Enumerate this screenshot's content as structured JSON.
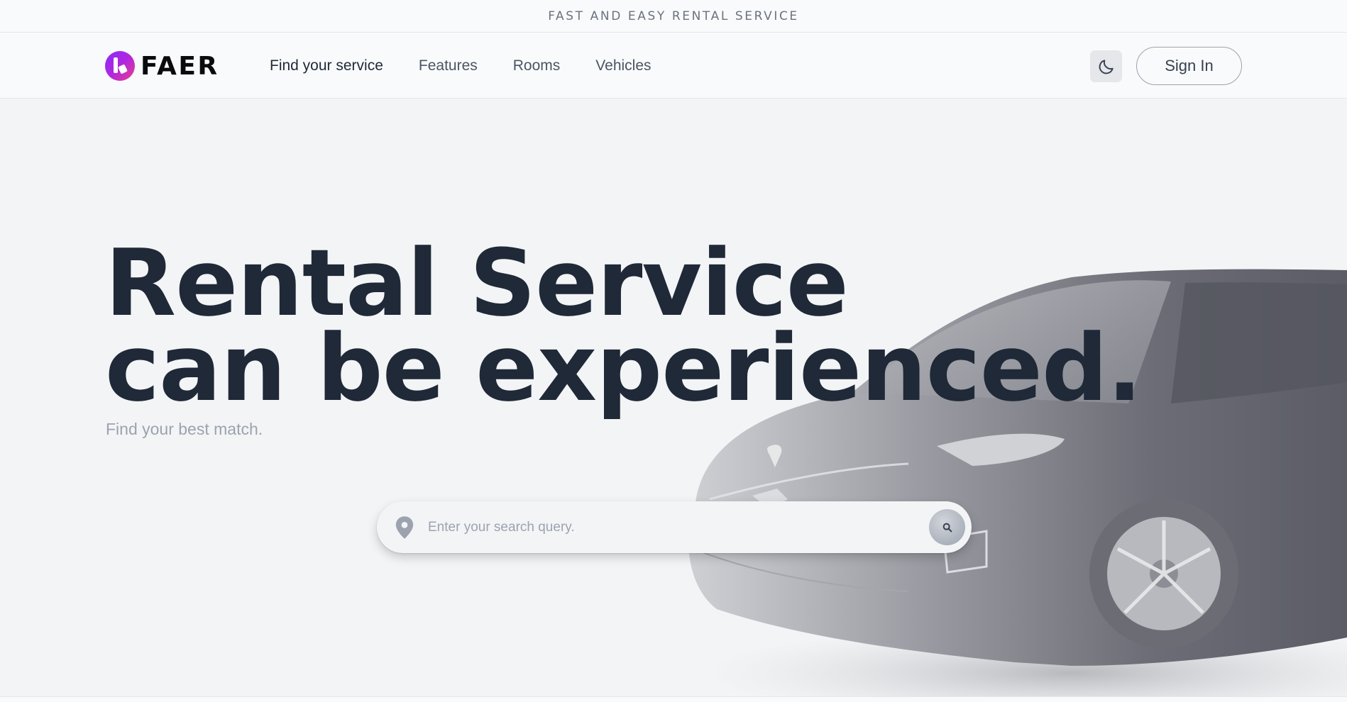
{
  "banner": {
    "text": "FAST AND EASY RENTAL SERVICE"
  },
  "brand": {
    "name": "FAER"
  },
  "nav": {
    "links": [
      {
        "label": "Find your service"
      },
      {
        "label": "Features"
      },
      {
        "label": "Rooms"
      },
      {
        "label": "Vehicles"
      }
    ],
    "theme_icon": "moon-icon",
    "signin_label": "Sign In"
  },
  "hero": {
    "title_line1": "Rental Service",
    "title_line2": "can be experienced.",
    "subtitle": "Find your best match."
  },
  "search": {
    "placeholder": "Enter your search query.",
    "location_icon": "map-pin-icon",
    "button_icon": "search-icon"
  },
  "colors": {
    "heading": "#1f2937",
    "muted": "#9ca3af",
    "brand_gradient_start": "#8b2cf5",
    "brand_gradient_end": "#e83e8c"
  }
}
